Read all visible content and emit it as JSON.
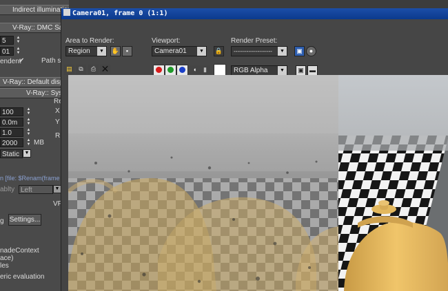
{
  "background_panel": {
    "rollouts": [
      "Indirect illumination",
      "V-Ray:: DMC Sa",
      "V-Ray:: Default disp",
      "V-Ray:: System"
    ],
    "fields_top": [
      "5",
      "01"
    ],
    "checkbox_label": "endent",
    "path_label": "Path sa",
    "system_fields": [
      "100",
      "0.0m",
      "1.0",
      "2000"
    ],
    "mb_unit": "MB",
    "static_select": "Static",
    "system_side_labels": [
      "Re",
      "X",
      "Y",
      "R"
    ],
    "file_header": "n [file: $Renam(frame",
    "left_label": "ablty",
    "left_select": "Left",
    "settings_left": "g",
    "settings_button": "Settings...",
    "vf_label": "VF",
    "bottom_text": [
      "nadeContext",
      "ace)",
      "les",
      "eric evaluation"
    ]
  },
  "window": {
    "title": "Camera01, frame 0 (1:1)",
    "area_label": "Area to Render:",
    "area_value": "Region",
    "viewport_label": "Viewport:",
    "viewport_value": "Camera01",
    "preset_label": "Render Preset:",
    "preset_value": "---------------------",
    "channel_value": "RGB Alpha",
    "colors": {
      "red": "#d81b1b",
      "green": "#1f9a2a",
      "blue": "#1a3fc8",
      "title_blue": "#0b3a8d"
    }
  }
}
